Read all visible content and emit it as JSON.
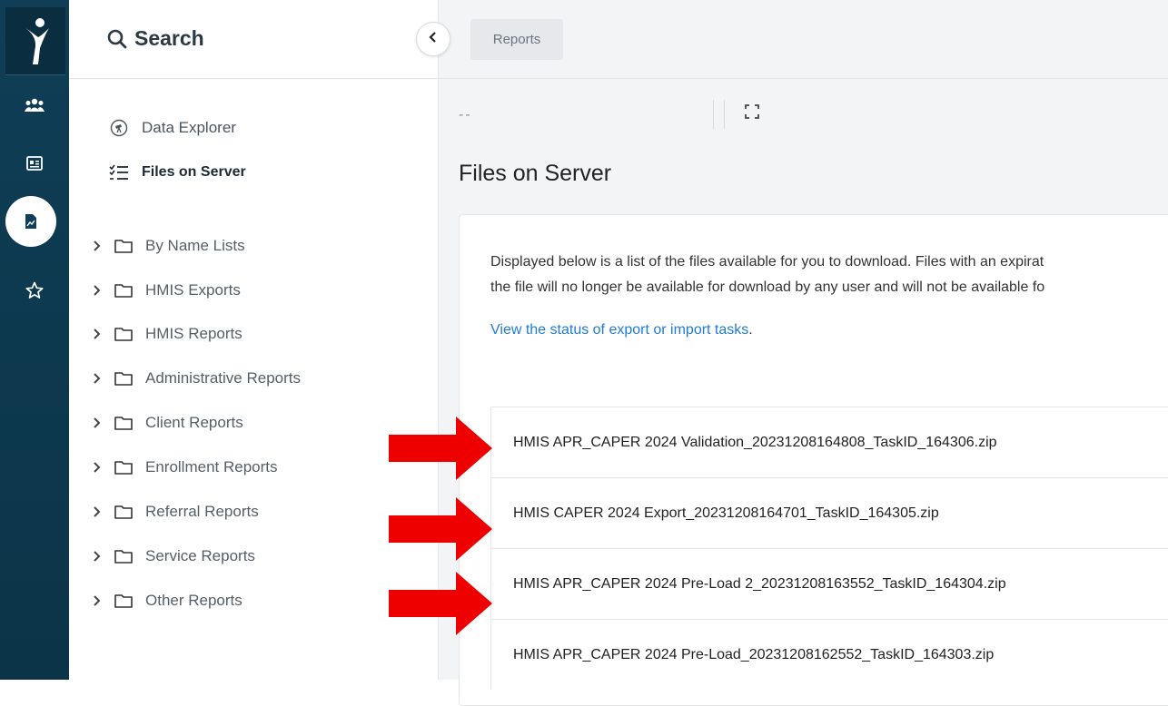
{
  "sidebar": {
    "search_label": "Search",
    "nav": [
      {
        "label": "Data Explorer",
        "icon": "telescope-icon"
      },
      {
        "label": "Files on Server",
        "icon": "checklist-icon"
      }
    ],
    "folders": [
      "By Name Lists",
      "HMIS Exports",
      "HMIS Reports",
      "Administrative Reports",
      "Client Reports",
      "Enrollment Reports",
      "Referral Reports",
      "Service Reports",
      "Other Reports"
    ]
  },
  "rail": {
    "icons": [
      "clients-icon",
      "id-card-icon",
      "reports-icon",
      "star-icon"
    ]
  },
  "main": {
    "tab_label": "Reports",
    "filter_placeholder": "--",
    "page_title": "Files on Server",
    "description_line1": "Displayed below is a list of the files available for you to download. Files with an expirat",
    "description_line2": "the file will no longer be available for download by any user and will not be available fo",
    "status_link": "View the status of export or import tasks",
    "status_link_suffix": ".",
    "files": [
      "HMIS APR_CAPER 2024 Validation_20231208164808_TaskID_164306.zip",
      "HMIS CAPER 2024 Export_20231208164701_TaskID_164305.zip",
      "HMIS APR_CAPER 2024 Pre-Load 2_20231208163552_TaskID_164304.zip",
      "HMIS APR_CAPER 2024 Pre-Load_20231208162552_TaskID_164303.zip"
    ]
  },
  "colors": {
    "rail": "#0f3e56",
    "link": "#1f7bd6",
    "annotation_arrow": "#ee0000"
  }
}
